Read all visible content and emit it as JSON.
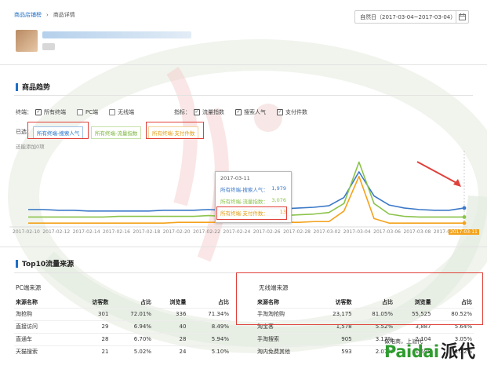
{
  "breadcrumb": {
    "root": "商品店铺榜",
    "current": "商品详情"
  },
  "date_range": {
    "label": "自然日（2017-03-04~2017-03-04）"
  },
  "trend": {
    "title": "商品趋势",
    "terminal_label": "终端：",
    "terminals": [
      {
        "label": "所有终端",
        "checked": true
      },
      {
        "label": "PC端",
        "checked": false
      },
      {
        "label": "无线端",
        "checked": false
      }
    ],
    "metric_label": "指标：",
    "metrics": [
      {
        "label": "流量指数",
        "checked": true
      },
      {
        "label": "搜索人气",
        "checked": true
      },
      {
        "label": "支付件数",
        "checked": true
      }
    ],
    "selected_label": "已选：",
    "selected_chips": [
      {
        "label": "所有终端-搜索人气",
        "color": "#1f6fc5"
      },
      {
        "label": "所有终端-流量指数",
        "color": "#7ab53d"
      },
      {
        "label": "所有终端-支付件数",
        "color": "#e39b12"
      }
    ],
    "added_note": "还能添加0项"
  },
  "tooltip": {
    "date": "2017-03-11",
    "rows": [
      {
        "label": "所有终端-搜索人气：",
        "value": "1,979"
      },
      {
        "label": "所有终端-流量指数：",
        "value": "3,076"
      },
      {
        "label": "所有终端-支付件数：",
        "value": "13"
      }
    ]
  },
  "chart_data": {
    "type": "line",
    "x": [
      "2017-02-10",
      "2017-02-11",
      "2017-02-12",
      "2017-02-13",
      "2017-02-14",
      "2017-02-15",
      "2017-02-16",
      "2017-02-17",
      "2017-02-18",
      "2017-02-19",
      "2017-02-20",
      "2017-02-21",
      "2017-02-22",
      "2017-02-23",
      "2017-02-24",
      "2017-02-25",
      "2017-02-26",
      "2017-02-27",
      "2017-02-28",
      "2017-03-01",
      "2017-03-02",
      "2017-03-03",
      "2017-03-04",
      "2017-03-05",
      "2017-03-06",
      "2017-03-07",
      "2017-03-08",
      "2017-03-09",
      "2017-03-10",
      "2017-03-11"
    ],
    "tick_labels": [
      "2017-02-10",
      "2017-02-12",
      "2017-02-14",
      "2017-02-16",
      "2017-02-18",
      "2017-02-20",
      "2017-02-22",
      "2017-02-24",
      "2017-02-26",
      "2017-02-28",
      "2017-03-02",
      "2017-03-04",
      "2017-03-06",
      "2017-03-08",
      "2017-03-10",
      "2017-03-11"
    ],
    "highlight_x": "2017-03-11",
    "series": [
      {
        "name": "所有终端-搜索人气",
        "color": "#3a78c8",
        "values": [
          22,
          22,
          21,
          21,
          20,
          20,
          20,
          20,
          20,
          21,
          21,
          21,
          22,
          21,
          22,
          22,
          23,
          23,
          24,
          25,
          27,
          38,
          72,
          40,
          28,
          24,
          22,
          21,
          21,
          24
        ]
      },
      {
        "name": "所有终端-流量指数",
        "color": "#8bc34a",
        "values": [
          12,
          12,
          12,
          12,
          12,
          12,
          13,
          13,
          13,
          13,
          13,
          13,
          14,
          13,
          14,
          14,
          14,
          14,
          15,
          16,
          18,
          30,
          85,
          30,
          16,
          13,
          12,
          12,
          12,
          12
        ]
      },
      {
        "name": "所有终端-支付件数",
        "color": "#f4a21b",
        "values": [
          4,
          4,
          4,
          4,
          4,
          4,
          4,
          4,
          4,
          4,
          5,
          5,
          5,
          5,
          5,
          5,
          5,
          5,
          5,
          6,
          6,
          20,
          66,
          10,
          4,
          4,
          4,
          4,
          4,
          4
        ]
      }
    ],
    "grid": false
  },
  "top10": {
    "title": "Top10流量来源",
    "pc": {
      "title": "PC端来源",
      "headers": [
        "来源名称",
        "访客数",
        "占比",
        "浏览量",
        "占比"
      ],
      "rows": [
        [
          "淘抢购",
          "301",
          "72.01%",
          "336",
          "71.34%"
        ],
        [
          "直接访问",
          "29",
          "6.94%",
          "40",
          "8.49%"
        ],
        [
          "直通车",
          "28",
          "6.70%",
          "28",
          "5.94%"
        ],
        [
          "天猫搜索",
          "21",
          "5.02%",
          "24",
          "5.10%"
        ]
      ]
    },
    "mobile": {
      "title": "无线端来源",
      "headers": [
        "来源名称",
        "访客数",
        "占比",
        "浏览量",
        "占比"
      ],
      "rows": [
        [
          "手淘淘抢购",
          "23,175",
          "81.05%",
          "55,525",
          "80.52%"
        ],
        [
          "淘宝客",
          "1,578",
          "5.52%",
          "3,887",
          "5.64%"
        ],
        [
          "手淘搜索",
          "905",
          "3.17%",
          "2,104",
          "3.05%"
        ],
        [
          "淘内免费其他",
          "593",
          "2.07%",
          "1,598",
          "2.32%"
        ]
      ]
    }
  },
  "watermark": {
    "brand": "Paidai",
    "brand_cn": "派代",
    "sub": "做电商，上派代"
  }
}
